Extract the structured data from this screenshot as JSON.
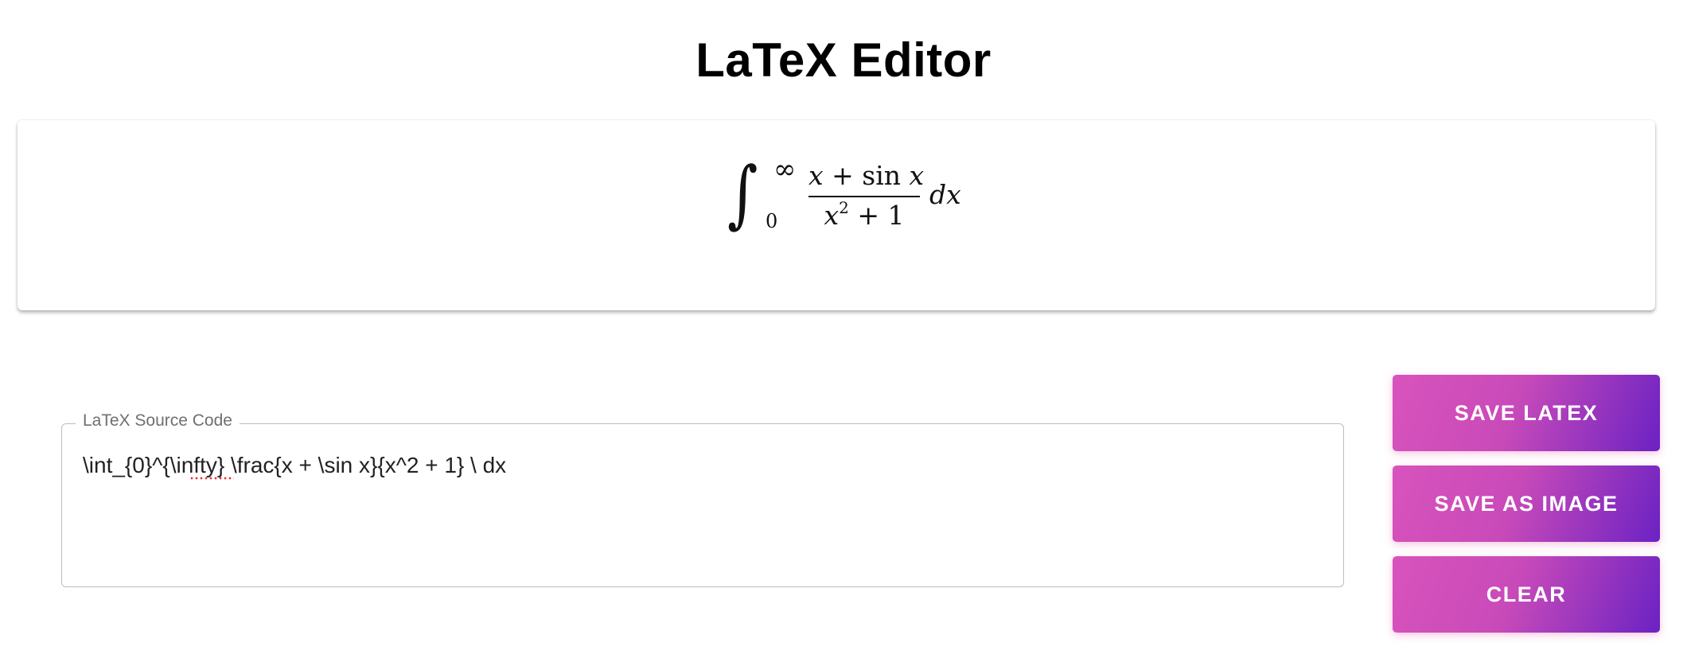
{
  "page": {
    "title": "LaTeX Editor"
  },
  "preview": {
    "integral_sign": "∫",
    "upper_limit": "∞",
    "lower_limit": "0",
    "numerator_x": "x",
    "numerator_plus": " + sin ",
    "numerator_x2": "x",
    "denominator_x": "x",
    "denominator_exp": "2",
    "denominator_rest": " + 1",
    "differential": "dx"
  },
  "editor": {
    "label": "LaTeX Source Code",
    "value": "\\int_{0}^{\\infty} \\frac{x + \\sin x}{x^2 + 1} \\ dx"
  },
  "actions": {
    "save_latex": "SAVE LATEX",
    "save_image": "SAVE AS IMAGE",
    "clear": "CLEAR"
  },
  "colors": {
    "button_gradient_start": "#d853bc",
    "button_gradient_end": "#6b22c3",
    "field_border": "#bdbdbd",
    "label_text": "#6f6f6f"
  }
}
